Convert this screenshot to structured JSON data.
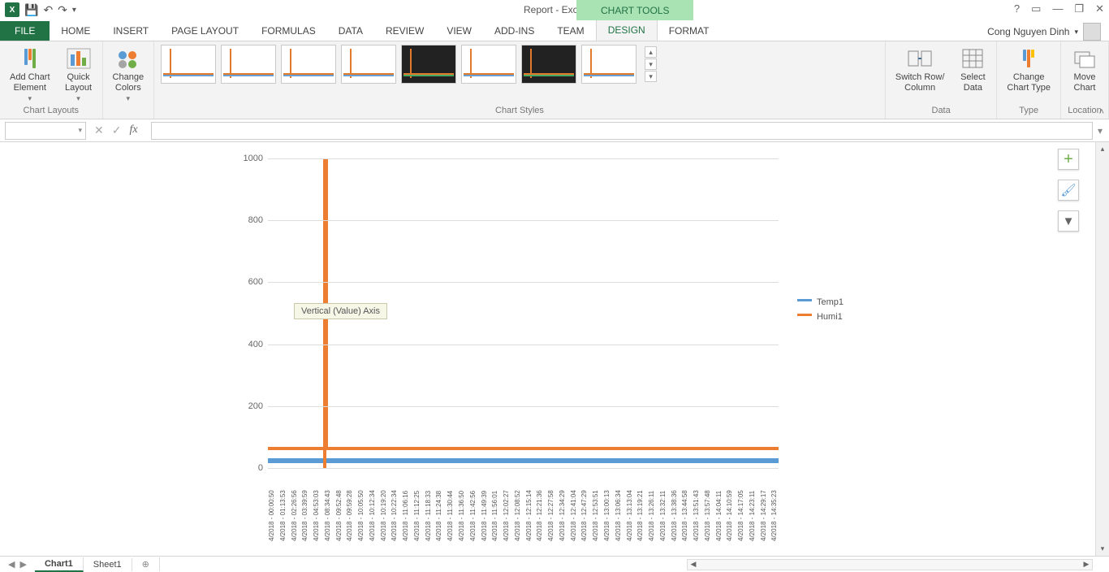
{
  "app": {
    "title": "Report - Excel",
    "contextual_tab_label": "CHART TOOLS",
    "user": "Cong Nguyen Dinh"
  },
  "tabs": {
    "file": "FILE",
    "items": [
      "HOME",
      "INSERT",
      "PAGE LAYOUT",
      "FORMULAS",
      "DATA",
      "REVIEW",
      "VIEW",
      "ADD-INS",
      "TEAM"
    ],
    "contextual": {
      "design": "DESIGN",
      "format": "FORMAT"
    }
  },
  "ribbon": {
    "add_chart_element": "Add Chart\nElement",
    "quick_layout": "Quick\nLayout",
    "change_colors": "Change\nColors",
    "switch_row_col": "Switch Row/\nColumn",
    "select_data": "Select\nData",
    "change_chart_type": "Change\nChart Type",
    "move_chart": "Move\nChart",
    "groups": {
      "chart_layouts": "Chart Layouts",
      "chart_styles": "Chart Styles",
      "data": "Data",
      "type": "Type",
      "location": "Location"
    }
  },
  "formula_bar": {
    "namebox": "",
    "fx": "fx",
    "formula": ""
  },
  "chart_data": {
    "type": "line",
    "series": [
      {
        "name": "Temp1",
        "color": "#5b9bd5",
        "baseline": 30,
        "values_note": "flat ~30 across all timestamps"
      },
      {
        "name": "Humi1",
        "color": "#ed7d31",
        "baseline": 75,
        "spike_value": 1000,
        "spike_at": "4/2018 - 08:34:43"
      }
    ],
    "yticks": [
      0,
      200,
      400,
      600,
      800,
      1000
    ],
    "ylim": [
      0,
      1000
    ],
    "x_categories": [
      "4/2018 - 00:00:50",
      "4/2018 - 01:13:53",
      "4/2018 - 02:26:56",
      "4/2018 - 03:39:59",
      "4/2018 - 04:53:03",
      "4/2018 - 08:34:43",
      "4/2018 - 09:52:48",
      "4/2018 - 09:59:28",
      "4/2018 - 10:05:50",
      "4/2018 - 10:12:34",
      "4/2018 - 10:19:20",
      "4/2018 - 10:22:34",
      "4/2018 - 11:06:16",
      "4/2018 - 11:12:25",
      "4/2018 - 11:18:33",
      "4/2018 - 11:24:38",
      "4/2018 - 11:30:44",
      "4/2018 - 11:36:50",
      "4/2018 - 11:42:56",
      "4/2018 - 11:49:39",
      "4/2018 - 11:56:01",
      "4/2018 - 12:02:27",
      "4/2018 - 12:08:52",
      "4/2018 - 12:15:14",
      "4/2018 - 12:21:36",
      "4/2018 - 12:27:58",
      "4/2018 - 12:34:29",
      "4/2018 - 12:41:04",
      "4/2018 - 12:47:29",
      "4/2018 - 12:53:51",
      "4/2018 - 13:00:13",
      "4/2018 - 13:06:34",
      "4/2018 - 13:13:04",
      "4/2018 - 13:19:21",
      "4/2018 - 13:26:11",
      "4/2018 - 13:32:11",
      "4/2018 - 13:38:36",
      "4/2018 - 13:44:58",
      "4/2018 - 13:51:43",
      "4/2018 - 13:57:48",
      "4/2018 - 14:04:11",
      "4/2018 - 14:10:59",
      "4/2018 - 14:17:05",
      "4/2018 - 14:23:11",
      "4/2018 - 14:29:17",
      "4/2018 - 14:35:23"
    ],
    "tooltip": "Vertical (Value) Axis"
  },
  "sheets": {
    "active": "Chart1",
    "other": "Sheet1"
  }
}
